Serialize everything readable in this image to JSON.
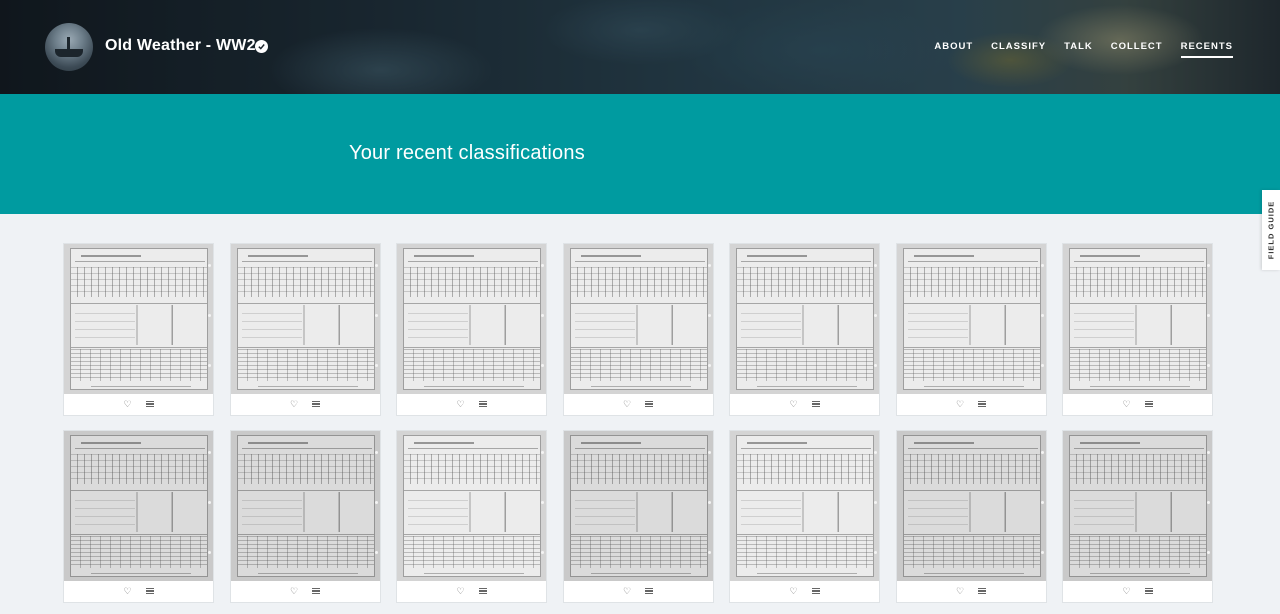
{
  "header": {
    "project_title": "Old Weather - WW2",
    "nav": [
      {
        "label": "ABOUT",
        "active": false
      },
      {
        "label": "CLASSIFY",
        "active": false
      },
      {
        "label": "TALK",
        "active": false
      },
      {
        "label": "COLLECT",
        "active": false
      },
      {
        "label": "RECENTS",
        "active": true
      }
    ]
  },
  "hero": {
    "title": "Your recent classifications"
  },
  "field_guide": {
    "label": "FIELD GUIDE"
  },
  "recents": {
    "rows": 2,
    "columns": 7,
    "items": [
      {
        "tone": "light"
      },
      {
        "tone": "light"
      },
      {
        "tone": "light"
      },
      {
        "tone": "light"
      },
      {
        "tone": "light"
      },
      {
        "tone": "light"
      },
      {
        "tone": "light"
      },
      {
        "tone": "dark"
      },
      {
        "tone": "dark"
      },
      {
        "tone": "light"
      },
      {
        "tone": "dark"
      },
      {
        "tone": "light"
      },
      {
        "tone": "dark"
      },
      {
        "tone": "dark"
      }
    ],
    "actions": {
      "favorite_icon": "heart-icon",
      "collect_icon": "collect-list-icon"
    }
  },
  "colors": {
    "hero_teal": "#009ba0",
    "page_background": "#eff2f5"
  }
}
